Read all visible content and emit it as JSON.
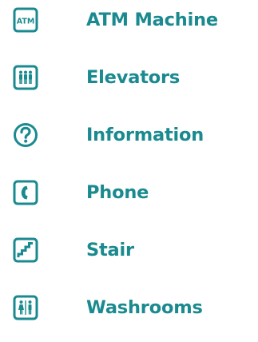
{
  "colors": {
    "icon": "#1a8a8f",
    "text": "#1a8a8f",
    "background": "#ffffff"
  },
  "legend": {
    "items": [
      {
        "icon": "atm-icon",
        "icon_text": "ATM",
        "label": "ATM Machine"
      },
      {
        "icon": "elevator-icon",
        "label": "Elevators"
      },
      {
        "icon": "question-mark-icon",
        "label": "Information"
      },
      {
        "icon": "phone-icon",
        "label": "Phone"
      },
      {
        "icon": "stair-icon",
        "label": "Stair"
      },
      {
        "icon": "washroom-icon",
        "label": "Washrooms"
      }
    ]
  }
}
